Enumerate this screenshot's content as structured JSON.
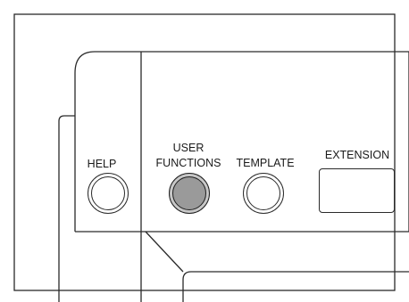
{
  "panel": {
    "help_label": "HELP",
    "user_functions_label_line1": "USER",
    "user_functions_label_line2": "FUNCTIONS",
    "template_label": "TEMPLATE",
    "extension_label": "EXTENSION"
  },
  "colors": {
    "outline": "#2a2a2a",
    "highlight_fill": "#9a9a9a",
    "background": "#ffffff"
  }
}
